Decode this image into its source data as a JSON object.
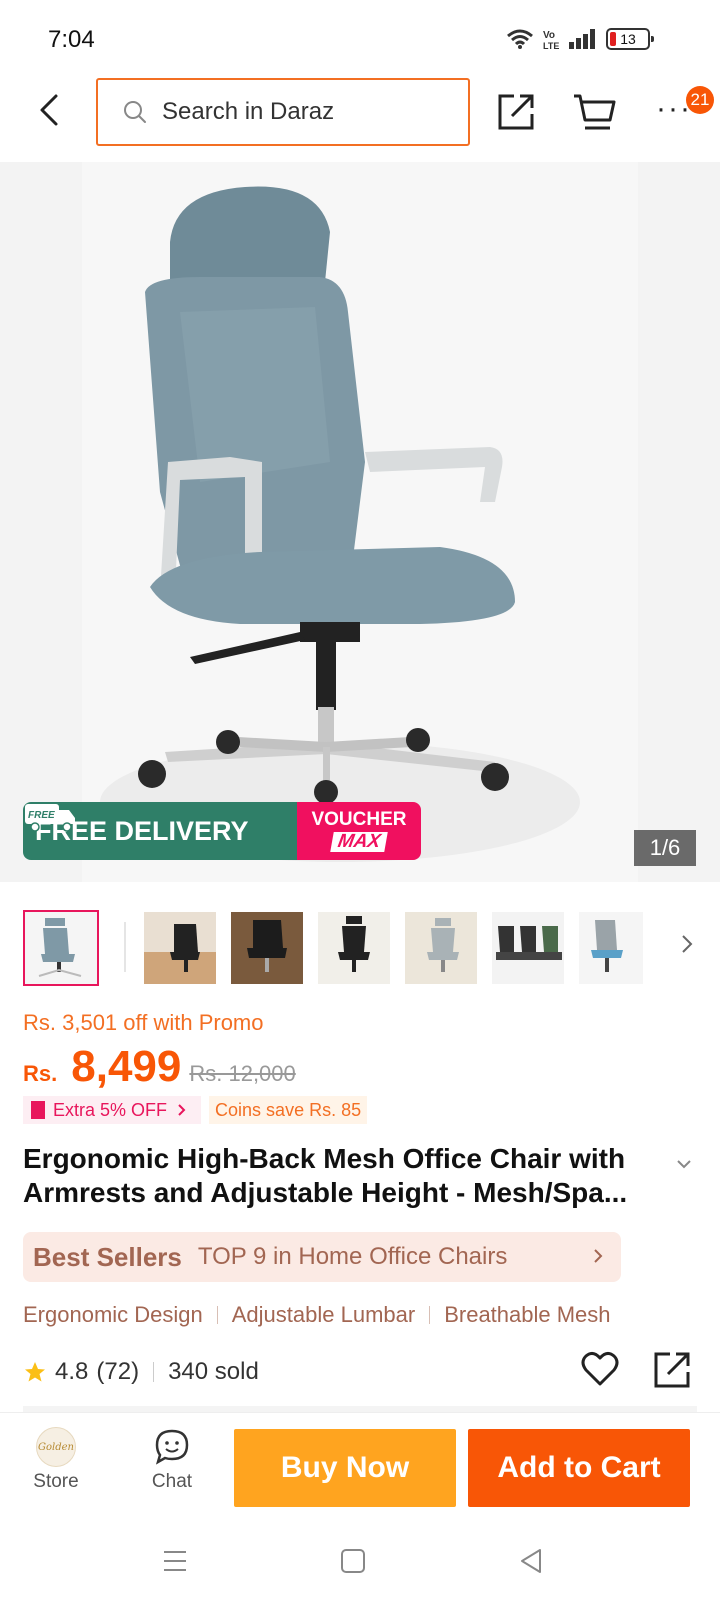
{
  "status_bar": {
    "time": "7:04",
    "battery": "13"
  },
  "top_nav": {
    "search_placeholder": "Search in Daraz",
    "cart_badge": "21",
    "more_label": "···"
  },
  "gallery": {
    "counter": "1/6",
    "free_delivery": "FREE DELIVERY",
    "free_tag": "FREE",
    "voucher_line1": "VOUCHER",
    "voucher_line2": "MAX"
  },
  "price": {
    "promo_text": "Rs. 3,501 off with Promo",
    "currency": "Rs.",
    "current": "8,499",
    "original": "Rs. 12,000",
    "extra_off": "Extra 5% OFF",
    "coins_save": "Coins save Rs. 85"
  },
  "product": {
    "title": "Ergonomic High-Back Mesh Office Chair with Armrests and Adjustable Height - Mesh/Spa..."
  },
  "bestsellers": {
    "label": "Best Sellers",
    "rank": "TOP 9 in Home Office Chairs"
  },
  "features": [
    "Ergonomic Design",
    "Adjustable Lumbar",
    "Breathable Mesh"
  ],
  "rating": {
    "score": "4.8",
    "count": "(72)",
    "sold": "340 sold"
  },
  "bottom_bar": {
    "store_label": "Store",
    "store_logo_text": "Golden",
    "chat_label": "Chat",
    "buy_now": "Buy Now",
    "add_to_cart": "Add to Cart"
  },
  "colors": {
    "accent_orange": "#f85606",
    "buy_now": "#ffa41f",
    "free_delivery_green": "#2f7f68",
    "voucher_pink": "#f0105f"
  }
}
